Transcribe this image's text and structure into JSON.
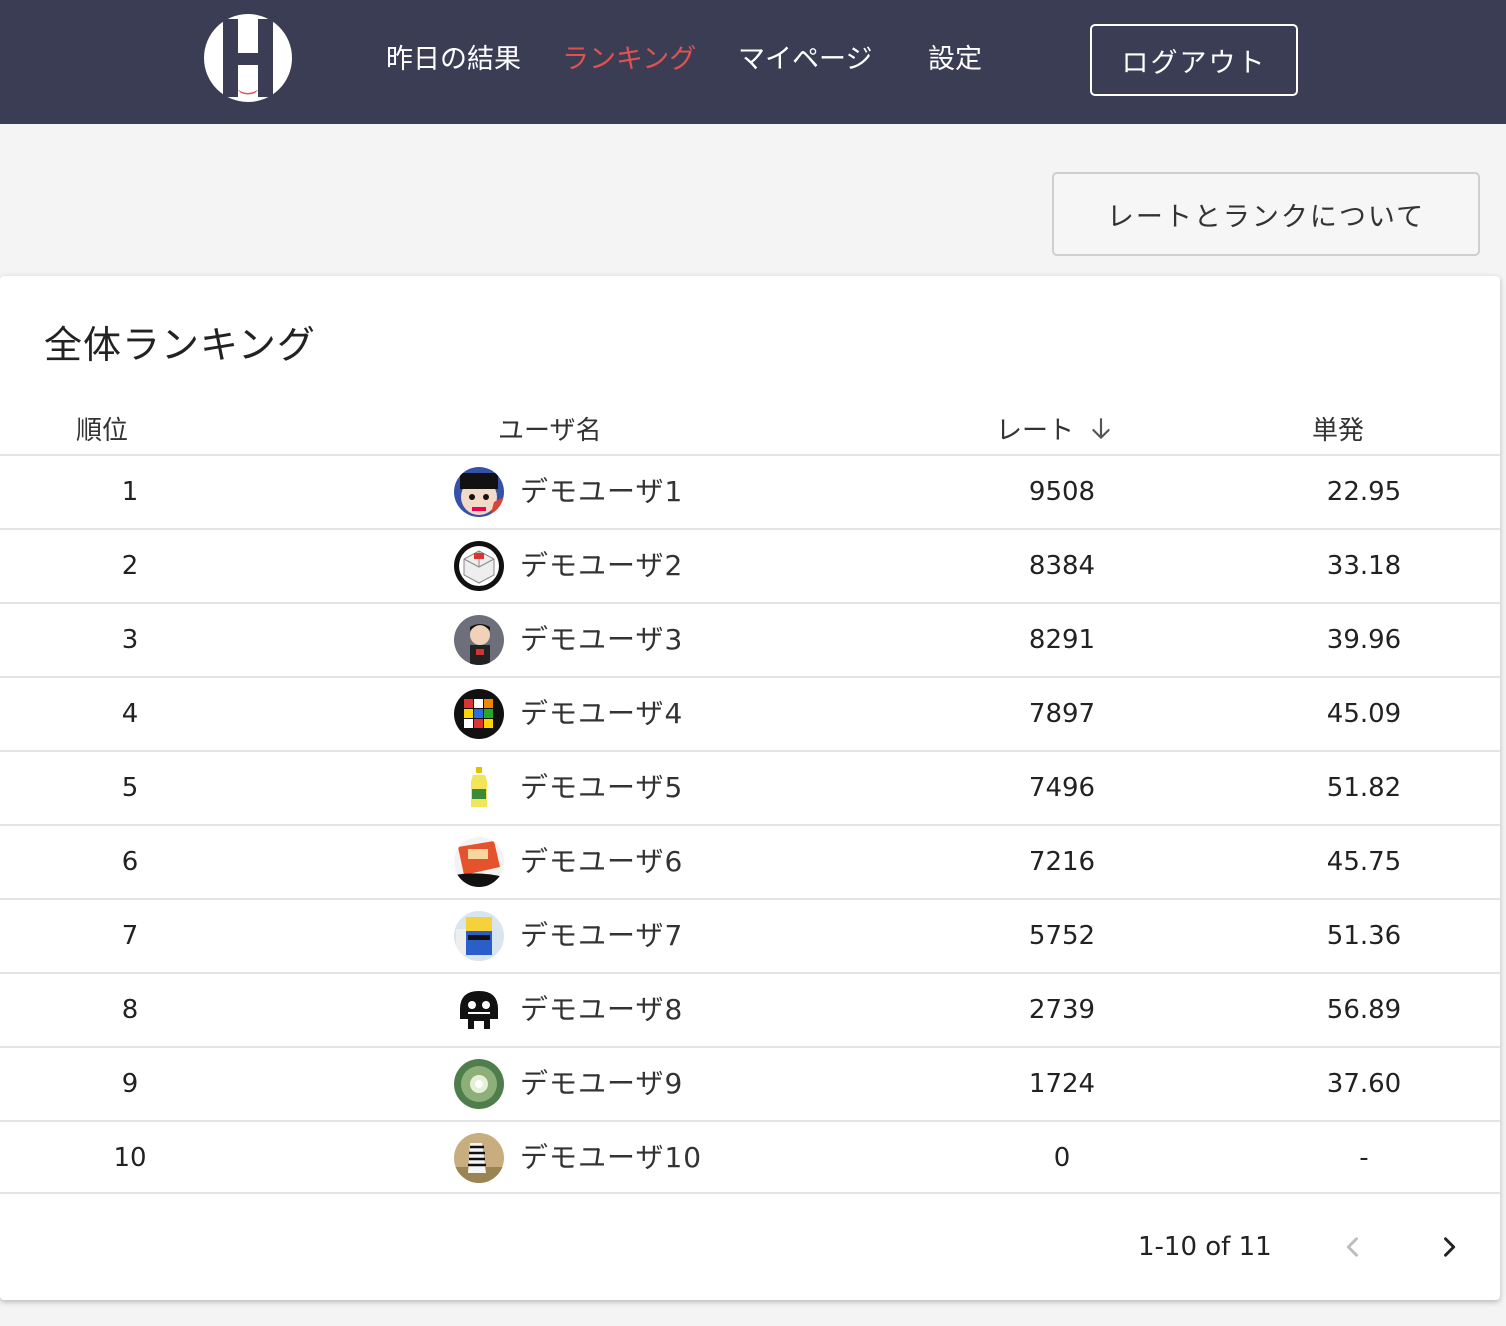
{
  "header": {
    "nav": [
      {
        "label": "昨日の結果",
        "active": false
      },
      {
        "label": "ランキング",
        "active": true
      },
      {
        "label": "マイページ",
        "active": false
      },
      {
        "label": "設定",
        "active": false
      }
    ],
    "logout_label": "ログアウト",
    "colors": {
      "background": "#3b3d54",
      "active": "#e0524f",
      "text": "#ffffff"
    }
  },
  "about_label": "レートとランクについて",
  "ranking": {
    "title": "全体ランキング",
    "columns": {
      "rank": "順位",
      "user": "ユーザ名",
      "rate": "レート",
      "single": "単発"
    },
    "sort_icon": "arrow-down-icon",
    "rows": [
      {
        "rank": "1",
        "user": "デモユーザ1",
        "rate": "9508",
        "single": "22.95"
      },
      {
        "rank": "2",
        "user": "デモユーザ2",
        "rate": "8384",
        "single": "33.18"
      },
      {
        "rank": "3",
        "user": "デモユーザ3",
        "rate": "8291",
        "single": "39.96"
      },
      {
        "rank": "4",
        "user": "デモユーザ4",
        "rate": "7897",
        "single": "45.09"
      },
      {
        "rank": "5",
        "user": "デモユーザ5",
        "rate": "7496",
        "single": "51.82"
      },
      {
        "rank": "6",
        "user": "デモユーザ6",
        "rate": "7216",
        "single": "45.75"
      },
      {
        "rank": "7",
        "user": "デモユーザ7",
        "rate": "5752",
        "single": "51.36"
      },
      {
        "rank": "8",
        "user": "デモユーザ8",
        "rate": "2739",
        "single": "56.89"
      },
      {
        "rank": "9",
        "user": "デモユーザ9",
        "rate": "1724",
        "single": "37.60"
      },
      {
        "rank": "10",
        "user": "デモユーザ10",
        "rate": "0",
        "single": "-"
      }
    ],
    "pagination": {
      "text": "1-10 of 11",
      "prev_icon": "chevron-left-icon",
      "next_icon": "chevron-right-icon"
    }
  }
}
